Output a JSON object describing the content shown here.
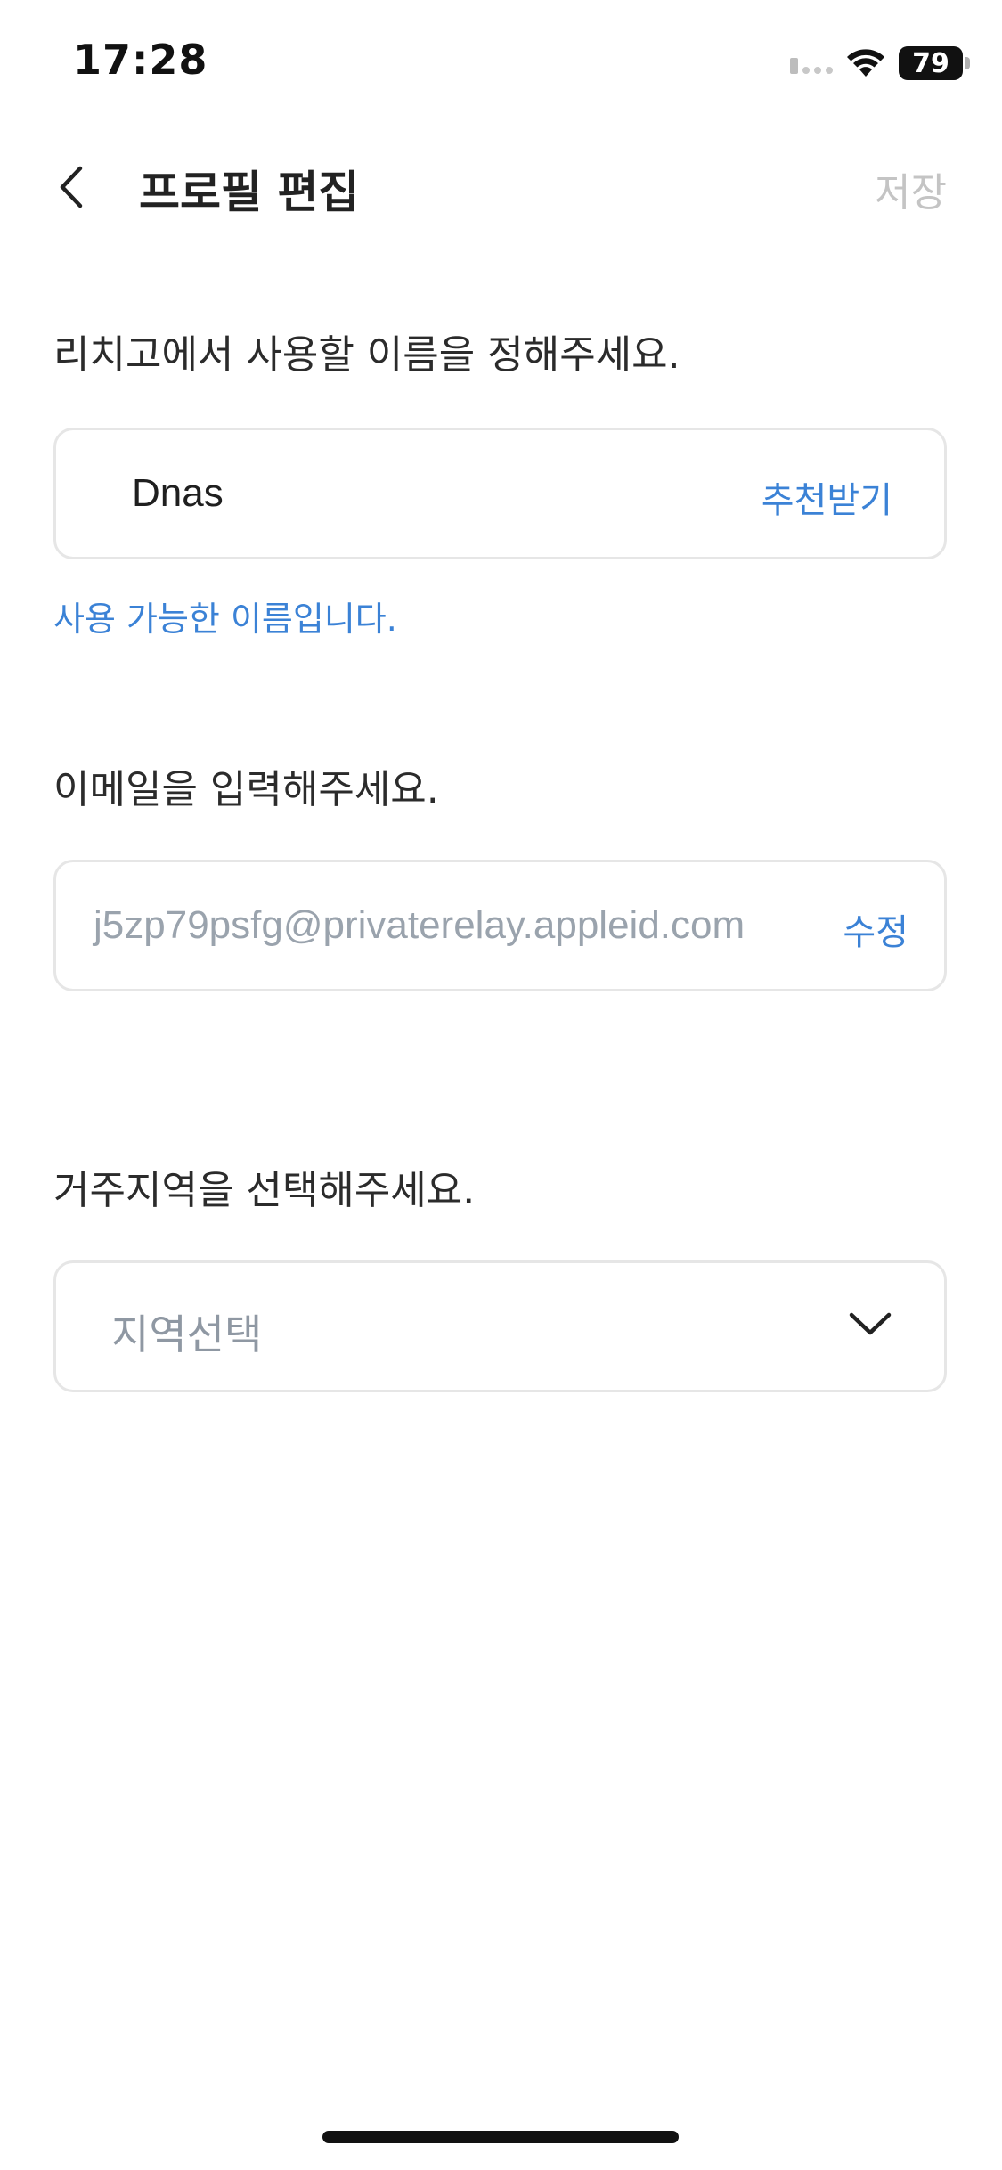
{
  "status_bar": {
    "time": "17:28",
    "battery": "79"
  },
  "header": {
    "title": "프로필 편집",
    "save_label": "저장"
  },
  "name_section": {
    "label": "리치고에서 사용할 이름을 정해주세요.",
    "value": "Dnas",
    "action_label": "추천받기",
    "helper": "사용 가능한 이름입니다."
  },
  "email_section": {
    "label": "이메일을 입력해주세요.",
    "value": "j5zp79psfg@privaterelay.appleid.com",
    "action_label": "수정"
  },
  "region_section": {
    "label": "거주지역을 선택해주세요.",
    "placeholder": "지역선택"
  },
  "colors": {
    "accent": "#3b82d6",
    "disabled_text": "#c4c4c4",
    "placeholder_text": "#8f98a3",
    "border": "#e6e6e6"
  }
}
